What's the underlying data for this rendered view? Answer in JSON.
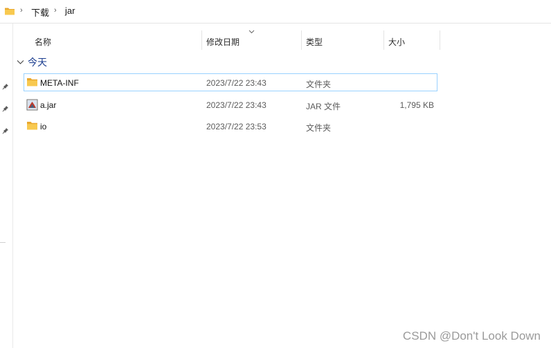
{
  "breadcrumb": {
    "items": [
      "下载",
      "jar"
    ],
    "separator": "›"
  },
  "columns": {
    "name": "名称",
    "date_modified": "修改日期",
    "type": "类型",
    "size": "大小"
  },
  "group": {
    "label": "今天"
  },
  "files": [
    {
      "name": "META-INF",
      "date": "2023/7/22 23:43",
      "type": "文件夹",
      "size": "",
      "icon": "folder-icon",
      "selected": true
    },
    {
      "name": "a.jar",
      "date": "2023/7/22 23:43",
      "type": "JAR 文件",
      "size": "1,795 KB",
      "icon": "jar-file-icon",
      "selected": false
    },
    {
      "name": "io",
      "date": "2023/7/22 23:53",
      "type": "文件夹",
      "size": "",
      "icon": "folder-icon",
      "selected": false
    }
  ],
  "watermark": "CSDN @Don't Look Down",
  "colors": {
    "folder": "#f5c04a",
    "selection_border": "#99d1ff",
    "group_label": "#1b3d8f"
  }
}
